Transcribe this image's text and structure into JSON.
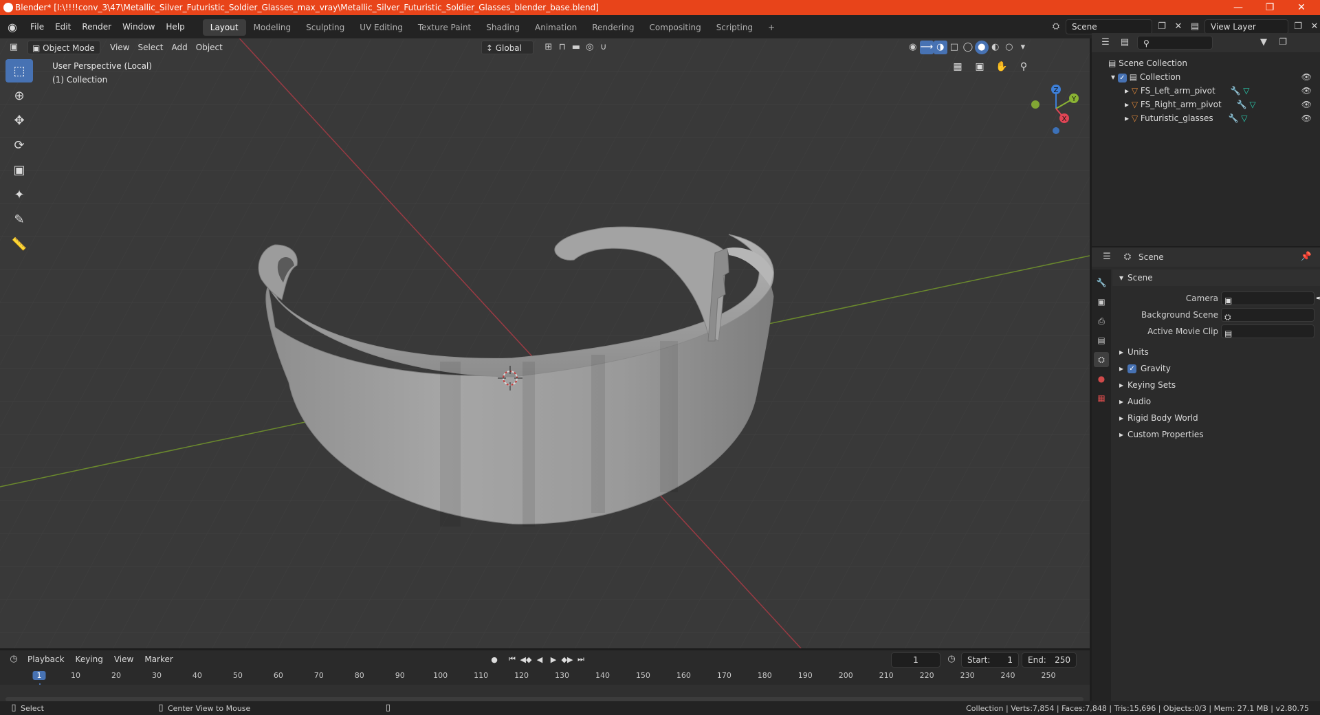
{
  "window": {
    "title": "Blender* [I:\\!!!!conv_3\\47\\Metallic_Silver_Futuristic_Soldier_Glasses_max_vray\\Metallic_Silver_Futuristic_Soldier_Glasses_blender_base.blend]",
    "minimize_icon": "minimize-icon",
    "maximize_icon": "maximize-icon",
    "close_icon": "close-icon"
  },
  "menu": [
    "File",
    "Edit",
    "Render",
    "Window",
    "Help"
  ],
  "workspaces": [
    "Layout",
    "Modeling",
    "Sculpting",
    "UV Editing",
    "Texture Paint",
    "Shading",
    "Animation",
    "Rendering",
    "Compositing",
    "Scripting"
  ],
  "active_workspace": "Layout",
  "scene_field": "Scene",
  "view_layer_field": "View Layer",
  "viewport": {
    "mode": "Object Mode",
    "menus": [
      "View",
      "Select",
      "Add",
      "Object"
    ],
    "orientation": "Global",
    "perspective_label": "User Perspective (Local)",
    "collection_label": "(1) Collection",
    "gizmo_axes": {
      "x": "X",
      "y": "Y",
      "z": "Z"
    }
  },
  "outliner": {
    "root": "Scene Collection",
    "collection": "Collection",
    "items": [
      "FS_Left_arm_pivot",
      "FS_Right_arm_pivot",
      "Futuristic_glasses"
    ]
  },
  "properties": {
    "header": "Scene",
    "panel": "Scene",
    "fields": [
      "Camera",
      "Background Scene",
      "Active Movie Clip"
    ],
    "sections": [
      "Units",
      "Gravity",
      "Keying Sets",
      "Audio",
      "Rigid Body World",
      "Custom Properties"
    ],
    "gravity_checked": true
  },
  "timeline": {
    "menus": [
      "Playback",
      "Keying",
      "View",
      "Marker"
    ],
    "current_frame": "1",
    "start_label": "Start:",
    "start_value": "1",
    "end_label": "End:",
    "end_value": "250",
    "ticks": [
      "1",
      "10",
      "20",
      "30",
      "40",
      "50",
      "60",
      "70",
      "80",
      "90",
      "100",
      "110",
      "120",
      "130",
      "140",
      "150",
      "160",
      "170",
      "180",
      "190",
      "200",
      "210",
      "220",
      "230",
      "240",
      "250"
    ]
  },
  "statusbar": {
    "left_action": "Select",
    "middle_action": "Center View to Mouse",
    "stats": "Collection | Verts:7,854 | Faces:7,848 | Tris:15,696 | Objects:0/3 | Mem: 27.1 MB | v2.80.75"
  },
  "colors": {
    "titlebar": "#e8441a",
    "accent": "#4772b3",
    "x_axis": "#e04555",
    "y_axis": "#8ab334",
    "z_axis": "#3d7fd8",
    "object_icon": "#e0883a",
    "mesh_icon": "#29d0b2"
  }
}
